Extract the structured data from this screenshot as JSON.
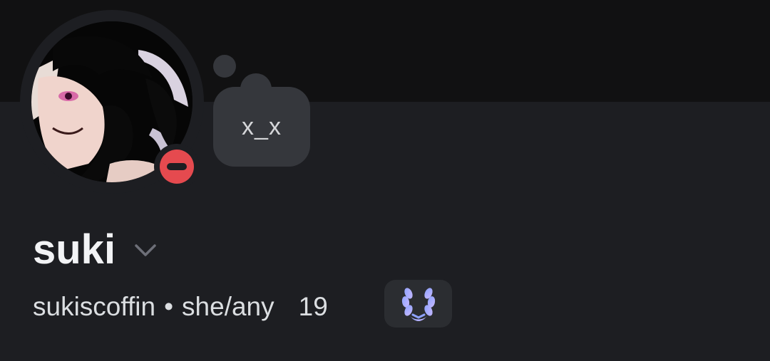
{
  "profile": {
    "display_name": "suki",
    "username": "sukiscoffin",
    "separator": "•",
    "pronouns": "she/any",
    "age": "19",
    "custom_status": "x_x",
    "presence": "do-not-disturb"
  },
  "icons": {
    "avatar": "anime-avatar-image",
    "status": "do-not-disturb-icon",
    "chevron": "chevron-down-icon",
    "badge": "laurel-wreath-badge-icon"
  },
  "colors": {
    "banner": "#111112",
    "background": "#1d1e22",
    "dnd_red": "#e54a4f",
    "bubble": "#35373c",
    "badge_bg": "#2b2d31",
    "badge_icon": "#a8a4ff"
  }
}
